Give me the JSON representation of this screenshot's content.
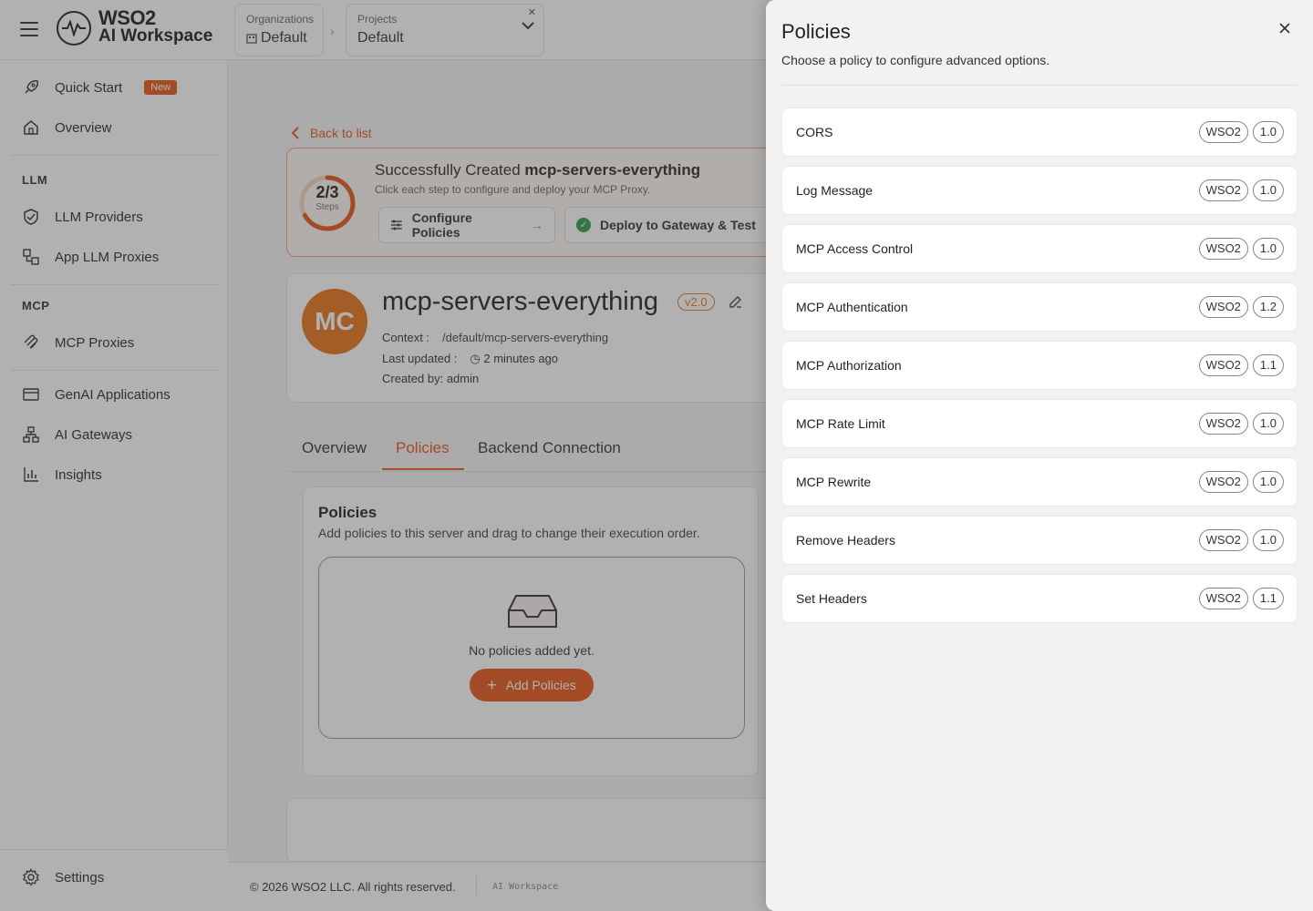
{
  "topbar": {
    "logo_line1": "WSO2",
    "logo_line2": "AI Workspace",
    "org_label": "Organizations",
    "org_value": "Default",
    "project_label": "Projects",
    "project_value": "Default"
  },
  "sidebar": {
    "quick_start": "Quick Start",
    "new_badge": "New",
    "overview": "Overview",
    "section_llm": "LLM",
    "llm_providers": "LLM Providers",
    "app_llm_proxies": "App LLM Proxies",
    "section_mcp": "MCP",
    "mcp_proxies": "MCP Proxies",
    "genai_applications": "GenAI Applications",
    "ai_gateways": "AI Gateways",
    "insights": "Insights",
    "settings": "Settings"
  },
  "main": {
    "back_link": "Back to list",
    "success_prefix": "Successfully Created ",
    "success_name": "mcp-servers-everything",
    "success_sub": "Click each step to configure and deploy your MCP Proxy.",
    "steps_count": "2/3",
    "steps_label": "Steps",
    "steps_progress": 0.67,
    "step_configure": "Configure Policies",
    "step_deploy": "Deploy to Gateway & Test",
    "avatar_initials": "MC",
    "proxy_name": "mcp-servers-everything",
    "version": "v2.0",
    "context_label": "Context :",
    "context_value": "/default/mcp-servers-everything",
    "updated_label": "Last updated :",
    "updated_value": "2 minutes ago",
    "created_by": "Created by: admin",
    "tabs": [
      "Overview",
      "Policies",
      "Backend Connection"
    ],
    "policies_title": "Policies",
    "policies_sub": "Add policies to this server and drag to change their execution order.",
    "empty_text": "No policies added yet.",
    "add_policies": "Add Policies"
  },
  "footer": {
    "copyright": "© 2026 WSO2 LLC. All rights reserved.",
    "product": "AI Workspace"
  },
  "drawer": {
    "title": "Policies",
    "subtitle": "Choose a policy to configure advanced options.",
    "policies": [
      {
        "name": "CORS",
        "vendor": "WSO2",
        "version": "1.0"
      },
      {
        "name": "Log Message",
        "vendor": "WSO2",
        "version": "1.0"
      },
      {
        "name": "MCP Access Control",
        "vendor": "WSO2",
        "version": "1.0"
      },
      {
        "name": "MCP Authentication",
        "vendor": "WSO2",
        "version": "1.2"
      },
      {
        "name": "MCP Authorization",
        "vendor": "WSO2",
        "version": "1.1"
      },
      {
        "name": "MCP Rate Limit",
        "vendor": "WSO2",
        "version": "1.0"
      },
      {
        "name": "MCP Rewrite",
        "vendor": "WSO2",
        "version": "1.0"
      },
      {
        "name": "Remove Headers",
        "vendor": "WSO2",
        "version": "1.0"
      },
      {
        "name": "Set Headers",
        "vendor": "WSO2",
        "version": "1.1"
      }
    ]
  },
  "colors": {
    "accent": "#e8541a",
    "success": "#2e9e4f"
  }
}
